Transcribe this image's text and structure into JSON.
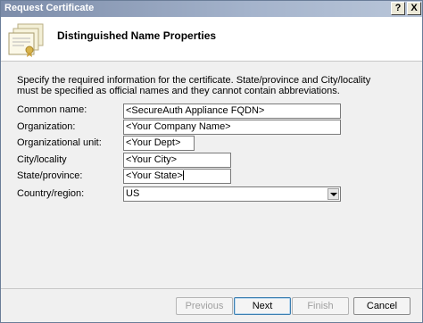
{
  "window": {
    "title": "Request Certificate"
  },
  "titlebar_buttons": {
    "help": "?",
    "close": "X"
  },
  "header": {
    "title": "Distinguished Name Properties",
    "icon": "certificate-icon"
  },
  "instructions": "Specify the required information for the certificate. State/province and City/locality must be specified as official names and they cannot contain abbreviations.",
  "fields": {
    "common_name": {
      "label": "Common name:",
      "value": "<SecureAuth Appliance FQDN>"
    },
    "organization": {
      "label": "Organization:",
      "value": "<Your Company Name>"
    },
    "org_unit": {
      "label": "Organizational unit:",
      "value": "<Your Dept>"
    },
    "city": {
      "label": "City/locality",
      "value": "<Your City>"
    },
    "state": {
      "label": "State/province:",
      "value": "<Your State>"
    },
    "country": {
      "label": "Country/region:",
      "value": "US"
    }
  },
  "buttons": {
    "previous": "Previous",
    "next": "Next",
    "finish": "Finish",
    "cancel": "Cancel"
  },
  "colors": {
    "titlebar": "#7c8ca9",
    "dialog_bg": "#f0f0f0",
    "default_button_border": "#3c7fb1"
  }
}
